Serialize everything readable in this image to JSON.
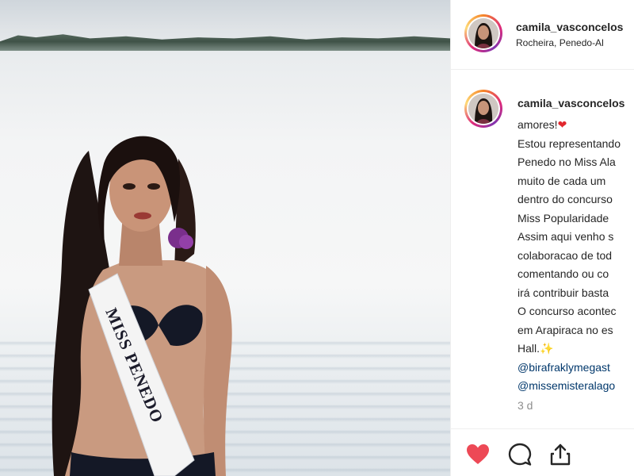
{
  "post": {
    "photo": {
      "sash_text": "MISS PENEDO"
    }
  },
  "header": {
    "username": "camila_vasconcelos",
    "location": "Rocheira, Penedo-Al"
  },
  "comment": {
    "username": "camila_vasconcelos",
    "lines": [
      "amores!",
      "Estou representando",
      "Penedo no Miss Ala",
      "muito de cada um",
      "dentro do concurso",
      "Miss Popularidade",
      "Assim aqui venho s",
      "colaboracao de tod",
      "comentando ou co",
      "irá contribuir basta",
      "O concurso acontec",
      "em Arapiraca no es",
      "Hall."
    ],
    "mentions": [
      "@birafraklymegast",
      "@missemisteralago"
    ],
    "time": "3 d",
    "emoji": {
      "heart": "❤",
      "sparkle": "✨"
    }
  },
  "actions": {
    "like_icon": "heart-icon",
    "comment_icon": "comment-icon",
    "share_icon": "share-icon",
    "like_color": "#ed4956"
  }
}
